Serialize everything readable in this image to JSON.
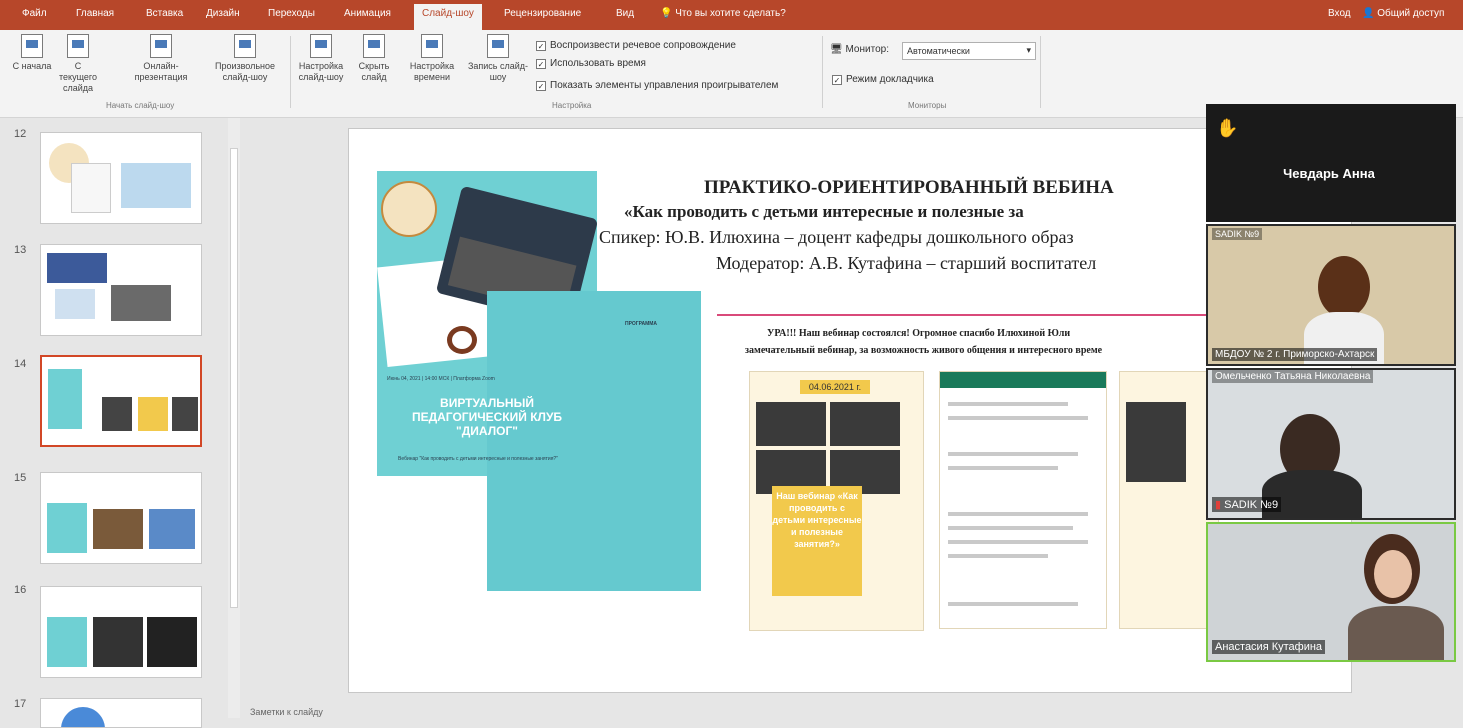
{
  "menubar": {
    "tabs": [
      "Файл",
      "Главная",
      "Вставка",
      "Дизайн",
      "Переходы",
      "Анимация",
      "Слайд-шоу",
      "Рецензирование",
      "Вид"
    ],
    "active_tab": "Слайд-шоу",
    "tell_me": "Что вы хотите сделать?",
    "login": "Вход",
    "share": "Общий доступ"
  },
  "ribbon": {
    "start_group": {
      "from_beginning": "С начала",
      "from_current": "С текущего слайда",
      "online": "Онлайн-презентация",
      "custom": "Произвольное слайд-шоу",
      "label": "Начать слайд-шоу"
    },
    "setup_group": {
      "setup": "Настройка слайд-шоу",
      "hide": "Скрыть слайд",
      "rehearse": "Настройка времени",
      "record": "Запись слайд-шоу",
      "play_narrations": "Воспроизвести речевое сопровождение",
      "use_timings": "Использовать время",
      "show_controls": "Показать элементы управления проигрывателем",
      "label": "Настройка"
    },
    "monitors_group": {
      "monitor_label": "Монитор:",
      "monitor_value": "Автоматически",
      "presenter_view": "Режим докладчика",
      "label": "Мониторы"
    }
  },
  "thumbnails": {
    "numbers": [
      "12",
      "13",
      "14",
      "15",
      "16",
      "17"
    ],
    "selected": "14"
  },
  "slide": {
    "title_line1": "ПРАКТИКО-ОРИЕНТИРОВАННЫЙ ВЕБИНА",
    "title_line2": "«Как проводить с детьми интересные и полезные за",
    "speaker": "Спикер: Ю.В. Илюхина – доцент кафедры дошкольного образ",
    "moderator": "Модератор: А.В. Кутафина – старший воспитател",
    "poster": {
      "title": "ВИРТУАЛЬНЫЙ ПЕДАГОГИЧЕСКИЙ КЛУБ \"ДИАЛОГ\"",
      "date": "Июнь 04, 2021 | 14:00 МСК | Платформа Zoom",
      "subtitle": "Вебинар \"Как проводить с детьми интересные и полезные занятия?\"",
      "program": "ПРОГРАММА"
    },
    "collage": {
      "caption_line1": "УРА!!! Наш вебинар состоялся! Огромное спасибо Илюхиной Юли",
      "caption_line2": "замечательный вебинар, за возможность живого общения и интересного време",
      "date_tag": "04.06.2021 г.",
      "yellow_note": "Наш вебинар «Как проводить с детьми интересные и полезные занятия?»"
    }
  },
  "zoom": {
    "host_name": "Чевдарь Анна",
    "participants": [
      {
        "name": "МБДОУ № 2 г. Приморско-Ахтарск",
        "top_name": "SADIK №9"
      },
      {
        "name": "SADIK №9",
        "top_name": "Омельченко Татьяна Николаевна"
      },
      {
        "name": "Анастасия Кутафина",
        "top_name": ""
      }
    ]
  },
  "status": {
    "notes_hint": "Заметки к слайду"
  },
  "colors": {
    "ribbon_accent": "#b7472a",
    "selected_thumb": "#d24726",
    "poster_teal": "#6fd0d3",
    "active_speaker": "#7ac943"
  }
}
